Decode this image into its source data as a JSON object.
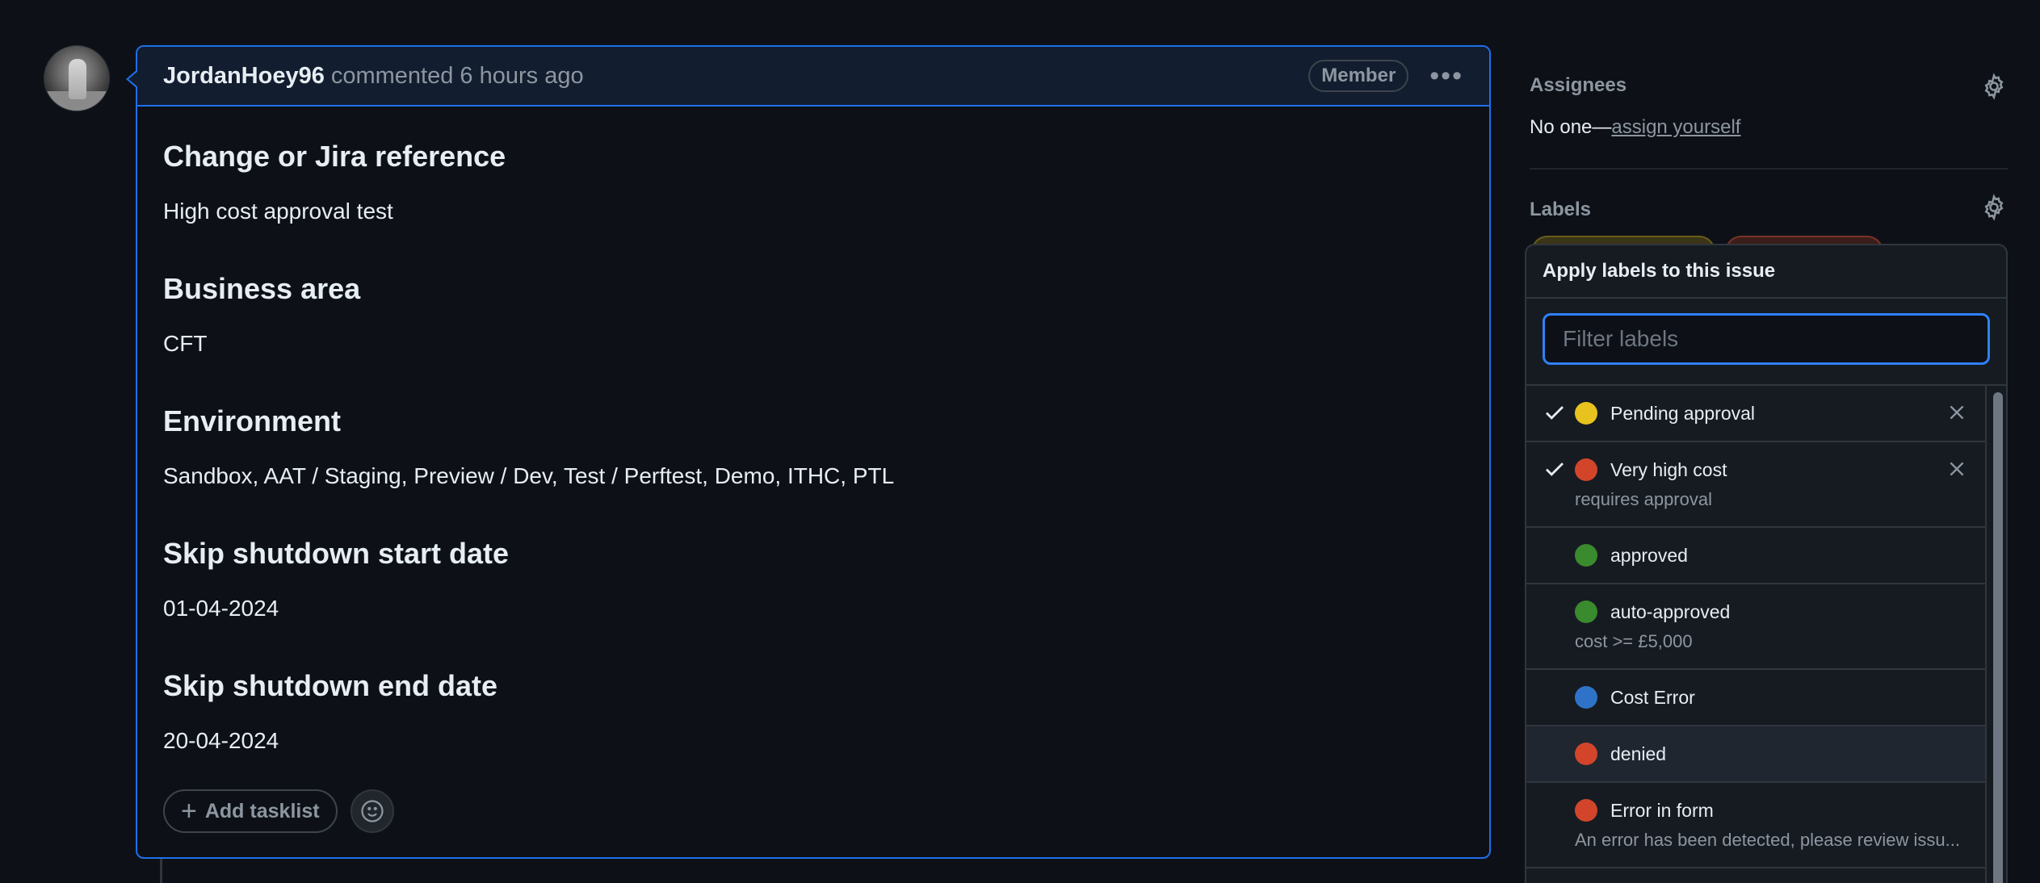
{
  "comment": {
    "author": "JordanHoey96",
    "action": "commented 6 hours ago",
    "badge": "Member",
    "sections": [
      {
        "heading": "Change or Jira reference",
        "value": "High cost approval test"
      },
      {
        "heading": "Business area",
        "value": "CFT"
      },
      {
        "heading": "Environment",
        "value": "Sandbox, AAT / Staging, Preview / Dev, Test / Perftest, Demo, ITHC, PTL"
      },
      {
        "heading": "Skip shutdown start date",
        "value": "01-04-2024"
      },
      {
        "heading": "Skip shutdown end date",
        "value": "20-04-2024"
      }
    ],
    "add_tasklist_label": "Add tasklist"
  },
  "sidebar": {
    "assignees_title": "Assignees",
    "assignees_none": "No one—",
    "assign_yourself": "assign yourself",
    "labels_title": "Labels"
  },
  "dropdown": {
    "title": "Apply labels to this issue",
    "filter_placeholder": "Filter labels",
    "labels": [
      {
        "name": "Pending approval",
        "desc": "",
        "color": "#e8c21e",
        "checked": true
      },
      {
        "name": "Very high cost",
        "desc": "requires approval",
        "color": "#d2452a",
        "checked": true
      },
      {
        "name": "approved",
        "desc": "",
        "color": "#3a8a2e",
        "checked": false
      },
      {
        "name": "auto-approved",
        "desc": "cost >= £5,000",
        "color": "#3a8a2e",
        "checked": false
      },
      {
        "name": "Cost Error",
        "desc": "",
        "color": "#2f73c9",
        "checked": false
      },
      {
        "name": "denied",
        "desc": "",
        "color": "#d2452a",
        "checked": false
      },
      {
        "name": "Error in form",
        "desc": "An error has been detected, please review issu...",
        "color": "#d2452a",
        "checked": false
      }
    ]
  }
}
